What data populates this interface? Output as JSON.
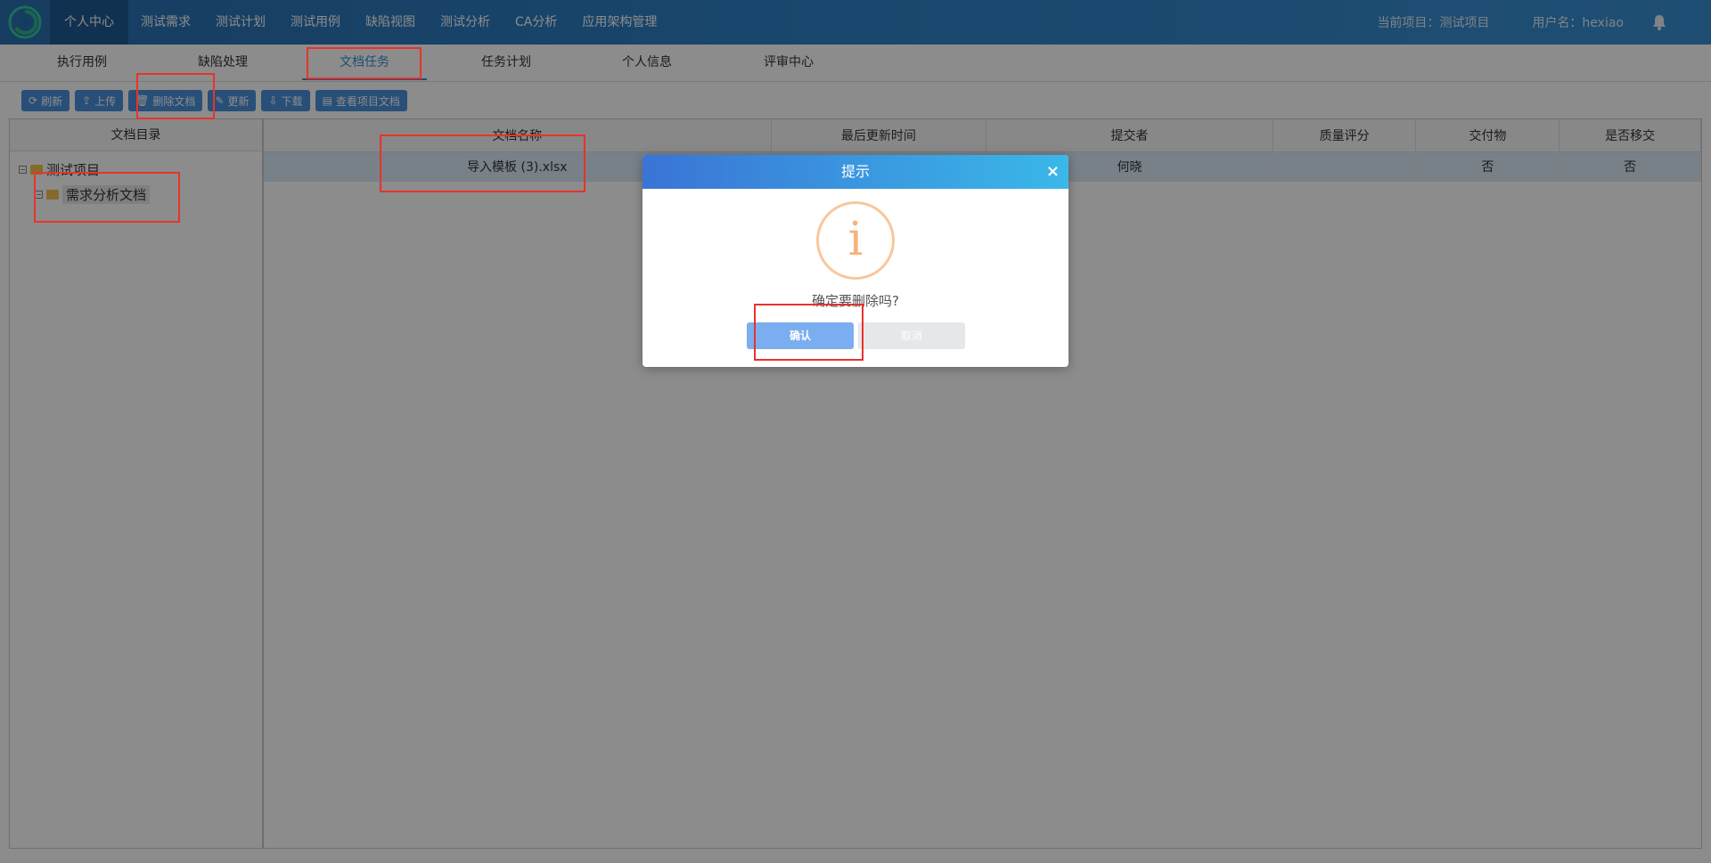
{
  "topnav": {
    "items": [
      "个人中心",
      "测试需求",
      "测试计划",
      "测试用例",
      "缺陷视图",
      "测试分析",
      "CA分析",
      "应用架构管理"
    ],
    "active_index": 0,
    "current_project": "当前项目：测试项目",
    "username": "用户名：hexiao"
  },
  "subtabs": {
    "items": [
      "执行用例",
      "缺陷处理",
      "文档任务",
      "任务计划",
      "个人信息",
      "评审中心"
    ],
    "active_index": 2
  },
  "toolbar": {
    "buttons": [
      {
        "label": "刷新",
        "icon": "refresh-icon"
      },
      {
        "label": "上传",
        "icon": "upload-icon"
      },
      {
        "label": "删除文档",
        "icon": "trash-icon"
      },
      {
        "label": "更新",
        "icon": "edit-icon"
      },
      {
        "label": "下载",
        "icon": "download-icon"
      },
      {
        "label": "查看项目文档",
        "icon": "document-icon"
      }
    ]
  },
  "tree": {
    "title": "文档目录",
    "root": "测试项目",
    "child": "需求分析文档"
  },
  "table": {
    "headers": [
      "文档名称",
      "最后更新时间",
      "提交者",
      "质量评分",
      "交付物",
      "是否移交"
    ],
    "rows": [
      {
        "name": "导入模板 (3).xlsx",
        "updated": "",
        "submitter": "何晓",
        "score": "",
        "deliverable": "否",
        "handover": "否"
      }
    ]
  },
  "modal": {
    "title": "提示",
    "close": "×",
    "icon_glyph": "i",
    "message": "确定要删除吗?",
    "confirm_label": "确认",
    "cancel_label": "取消"
  },
  "colors": {
    "nav_bg": "#2e7fc4",
    "accent": "#3a8fd3",
    "annotation": "#e8332b",
    "confirm": "#7aaef0"
  }
}
